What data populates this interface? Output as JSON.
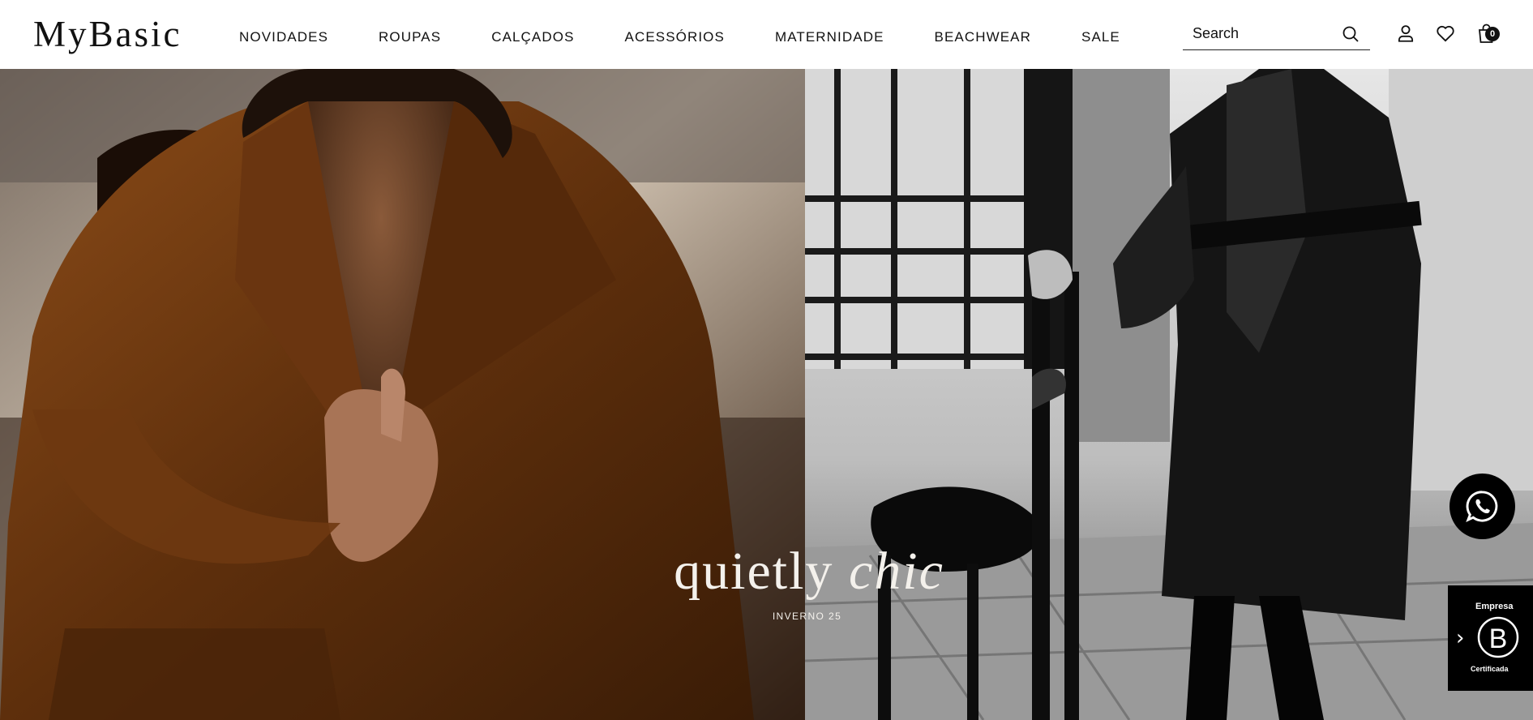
{
  "brand": {
    "logo_text": "MyBasic"
  },
  "nav": {
    "items": [
      {
        "label": "NOVIDADES"
      },
      {
        "label": "ROUPAS"
      },
      {
        "label": "CALÇADOS"
      },
      {
        "label": "ACESSÓRIOS"
      },
      {
        "label": "MATERNIDADE"
      },
      {
        "label": "BEACHWEAR"
      },
      {
        "label": "SALE"
      }
    ]
  },
  "search": {
    "placeholder": "Search"
  },
  "header_icons": {
    "account": "user-icon",
    "wishlist": "heart-icon",
    "cart": "shopping-bag-icon",
    "cart_count": "0"
  },
  "hero": {
    "headline_part1": "quietly ",
    "headline_part2": "chic",
    "subline": "INVERNO 25",
    "left_image_color": "#6b3a12",
    "right_image_color": "#2a2a2a"
  },
  "floating": {
    "whatsapp_icon": "whatsapp-icon",
    "bcorp_top": "Empresa",
    "bcorp_bottom": "Certificada",
    "bcorp_letter": "B"
  }
}
